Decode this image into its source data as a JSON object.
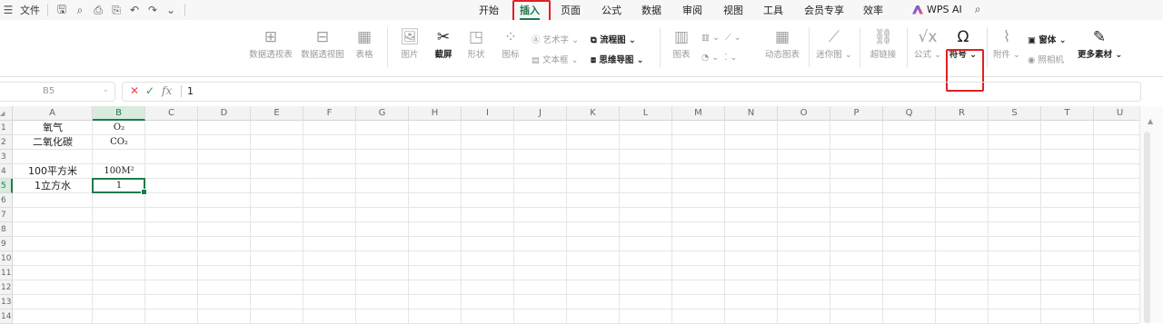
{
  "topbar": {
    "menu_label": "文件",
    "tabs": [
      "开始",
      "插入",
      "页面",
      "公式",
      "数据",
      "审阅",
      "视图",
      "工具",
      "会员专享",
      "效率"
    ],
    "active_tab": "插入",
    "wps_ai": "WPS AI"
  },
  "ribbon": {
    "pivot_table": "数据透视表",
    "pivot_chart": "数据透视图",
    "table": "表格",
    "picture": "图片",
    "screenshot": "截屏",
    "shape": "形状",
    "icon": "图标",
    "wordart": "艺术字",
    "textbox": "文本框",
    "flowchart": "流程图",
    "mindmap": "思维导图",
    "chart": "图表",
    "dynamic_chart": "动态图表",
    "sparkline": "迷你图",
    "hyperlink": "超链接",
    "formula": "公式",
    "symbol": "符号",
    "attachment": "附件",
    "camera": "照相机",
    "window": "窗体",
    "more_assets": "更多素材"
  },
  "formula_bar": {
    "name_box": "B5",
    "fx_label": "fx",
    "value": "1"
  },
  "sheet": {
    "columns": [
      "A",
      "B",
      "C",
      "D",
      "E",
      "F",
      "G",
      "H",
      "I",
      "J",
      "K",
      "L",
      "M",
      "N",
      "O",
      "P",
      "Q",
      "R",
      "S",
      "T",
      "U"
    ],
    "rows": [
      "1",
      "2",
      "3",
      "4",
      "5",
      "6",
      "7",
      "8",
      "9",
      "10",
      "11",
      "12",
      "13",
      "14"
    ],
    "cells": {
      "A1": "氧气",
      "B1": "O₂",
      "A2": "二氧化碳",
      "B2": "CO₂",
      "A4": "100平方米",
      "B4": "100M²",
      "A5": "1立方水",
      "B5": "1"
    },
    "selected_cell": "B5"
  }
}
